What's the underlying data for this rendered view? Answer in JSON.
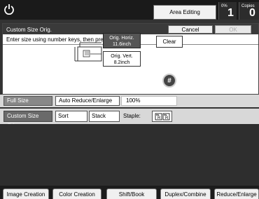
{
  "topbar": {
    "area_editing": "Area Editing",
    "counter_unit": "0%",
    "counter_value": "1",
    "copies_label": "Copies",
    "copies_value": "0"
  },
  "dialog": {
    "title": "Custom Size Orig.",
    "cancel": "Cancel",
    "ok": "OK",
    "instruction": "Enter size using number keys, then press # key.",
    "orig_horiz_label": "Orig. Horiz.",
    "orig_horiz_value": "11.6inch",
    "orig_vert_label": "Orig. Vert.",
    "orig_vert_value": "8.2inch",
    "clear": "Clear",
    "hash": "#"
  },
  "settings": {
    "full_size": "Full Size",
    "auto_reduce": "Auto Reduce/Enlarge",
    "ratio": "100%",
    "custom_size": "Custom Size Orig.",
    "sort": "Sort",
    "stack": "Stack",
    "staple": "Staple:"
  },
  "tabs": [
    "Image Creation",
    "Color Creation",
    "Shift/Book",
    "Duplex/Combine",
    "Reduce/Enlarge"
  ],
  "colors": {
    "selected": "#555555",
    "panel": "#d8d8d8",
    "background": "#2e2e2e"
  }
}
